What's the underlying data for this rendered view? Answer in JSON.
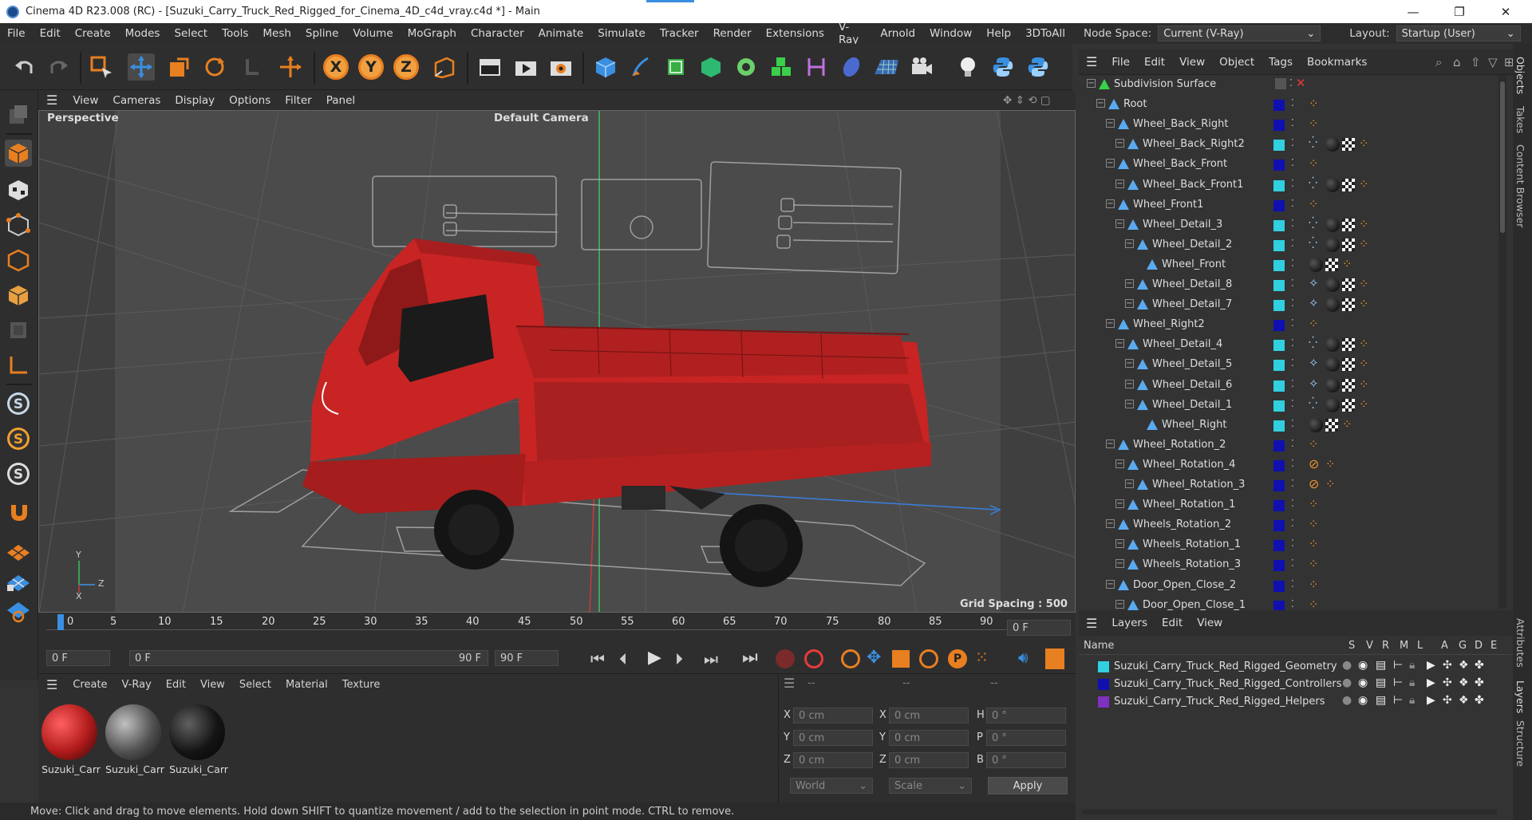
{
  "title_bar": {
    "title": "Cinema 4D R23.008 (RC) - [Suzuki_Carry_Truck_Red_Rigged_for_Cinema_4D_c4d_vray.c4d *] - Main",
    "minimize": "—",
    "restore": "❐",
    "close": "✕"
  },
  "menu": [
    "File",
    "Edit",
    "Create",
    "Modes",
    "Select",
    "Tools",
    "Mesh",
    "Spline",
    "Volume",
    "MoGraph",
    "Character",
    "Animate",
    "Simulate",
    "Tracker",
    "Render",
    "Extensions",
    "V-Ray",
    "Arnold",
    "Window",
    "Help",
    "3DToAll"
  ],
  "node_space": {
    "label": "Node Space:",
    "value": "Current (V-Ray)"
  },
  "layout": {
    "label": "Layout:",
    "value": "Startup (User)"
  },
  "axis_buttons": [
    "X",
    "Y",
    "Z"
  ],
  "viewport": {
    "menu": [
      "View",
      "Cameras",
      "Display",
      "Options",
      "Filter",
      "Panel"
    ],
    "view_name": "Perspective",
    "camera": "Default Camera",
    "grid_spacing": "Grid Spacing : 500 cm",
    "axis_labels": [
      "Y",
      "Z",
      "X"
    ]
  },
  "timeline": {
    "ticks": [
      "0",
      "5",
      "10",
      "15",
      "20",
      "25",
      "30",
      "35",
      "40",
      "45",
      "50",
      "55",
      "60",
      "65",
      "70",
      "75",
      "80",
      "85",
      "90"
    ],
    "current_frame": "0 F"
  },
  "transport": {
    "start": "0 F",
    "min": "0 F",
    "max_inner": "90 F",
    "end": "90 F"
  },
  "material_panel": {
    "menu": [
      "Create",
      "V-Ray",
      "Edit",
      "View",
      "Select",
      "Material",
      "Texture"
    ],
    "materials": [
      {
        "name": "Suzuki_Carr"
      },
      {
        "name": "Suzuki_Carr"
      },
      {
        "name": "Suzuki_Carr"
      }
    ]
  },
  "coords": {
    "headers": [
      "--",
      "--",
      "--"
    ],
    "rows": [
      {
        "a": "X",
        "av": "0 cm",
        "b": "X",
        "bv": "0 cm",
        "c": "H",
        "cv": "0 °"
      },
      {
        "a": "Y",
        "av": "0 cm",
        "b": "Y",
        "bv": "0 cm",
        "c": "P",
        "cv": "0 °"
      },
      {
        "a": "Z",
        "av": "0 cm",
        "b": "Z",
        "bv": "0 cm",
        "c": "B",
        "cv": "0 °"
      }
    ],
    "world": "World",
    "scale": "Scale",
    "apply": "Apply"
  },
  "status": "Move: Click and drag to move elements. Hold down SHIFT to quantize movement / add to the selection in point mode. CTRL to remove.",
  "object_manager": {
    "menu": [
      "File",
      "Edit",
      "View",
      "Object",
      "Tags",
      "Bookmarks"
    ],
    "objects": [
      {
        "name": "Subdivision Surface",
        "depth": 0,
        "color": "#ffffff",
        "tags": "sub"
      },
      {
        "name": "Root",
        "depth": 1,
        "color": "#1010b0",
        "tags": "d"
      },
      {
        "name": "Wheel_Back_Right",
        "depth": 2,
        "color": "#1010b0",
        "tags": "d"
      },
      {
        "name": "Wheel_Back_Right2",
        "depth": 3,
        "color": "#30d0e0",
        "tags": "full"
      },
      {
        "name": "Wheel_Back_Front",
        "depth": 2,
        "color": "#1010b0",
        "tags": "d"
      },
      {
        "name": "Wheel_Back_Front1",
        "depth": 3,
        "color": "#30d0e0",
        "tags": "full"
      },
      {
        "name": "Wheel_Front1",
        "depth": 2,
        "color": "#1010b0",
        "tags": "d"
      },
      {
        "name": "Wheel_Detail_3",
        "depth": 3,
        "color": "#30d0e0",
        "tags": "full"
      },
      {
        "name": "Wheel_Detail_2",
        "depth": 4,
        "color": "#30d0e0",
        "tags": "full"
      },
      {
        "name": "Wheel_Front",
        "depth": 5,
        "color": "#30d0e0",
        "tags": "mat"
      },
      {
        "name": "Wheel_Detail_8",
        "depth": 4,
        "color": "#30d0e0",
        "tags": "full2"
      },
      {
        "name": "Wheel_Detail_7",
        "depth": 4,
        "color": "#30d0e0",
        "tags": "full2"
      },
      {
        "name": "Wheel_Right2",
        "depth": 2,
        "color": "#1010b0",
        "tags": "d"
      },
      {
        "name": "Wheel_Detail_4",
        "depth": 3,
        "color": "#30d0e0",
        "tags": "full"
      },
      {
        "name": "Wheel_Detail_5",
        "depth": 4,
        "color": "#30d0e0",
        "tags": "full2"
      },
      {
        "name": "Wheel_Detail_6",
        "depth": 4,
        "color": "#30d0e0",
        "tags": "full2"
      },
      {
        "name": "Wheel_Detail_1",
        "depth": 4,
        "color": "#30d0e0",
        "tags": "full"
      },
      {
        "name": "Wheel_Right",
        "depth": 5,
        "color": "#30d0e0",
        "tags": "mat"
      },
      {
        "name": "Wheel_Rotation_2",
        "depth": 2,
        "color": "#1010b0",
        "tags": "d"
      },
      {
        "name": "Wheel_Rotation_4",
        "depth": 3,
        "color": "#1010b0",
        "tags": "ban"
      },
      {
        "name": "Wheel_Rotation_3",
        "depth": 4,
        "color": "#1010b0",
        "tags": "ban"
      },
      {
        "name": "Wheel_Rotation_1",
        "depth": 3,
        "color": "#1010b0",
        "tags": "d"
      },
      {
        "name": "Wheels_Rotation_2",
        "depth": 2,
        "color": "#1010b0",
        "tags": "d"
      },
      {
        "name": "Wheels_Rotation_1",
        "depth": 3,
        "color": "#1010b0",
        "tags": "d"
      },
      {
        "name": "Wheels_Rotation_3",
        "depth": 3,
        "color": "#1010b0",
        "tags": "d"
      },
      {
        "name": "Door_Open_Close_2",
        "depth": 2,
        "color": "#1010b0",
        "tags": "d"
      },
      {
        "name": "Door_Open_Close_1",
        "depth": 3,
        "color": "#1010b0",
        "tags": "d"
      }
    ]
  },
  "layer_manager": {
    "menu": [
      "Layers",
      "Edit",
      "View"
    ],
    "col_name": "Name",
    "cols": [
      "S",
      "V",
      "R",
      "M",
      "L",
      "A",
      "G",
      "D",
      "E"
    ],
    "layers": [
      {
        "name": "Suzuki_Carry_Truck_Red_Rigged_Geometry",
        "color": "#30d0e0"
      },
      {
        "name": "Suzuki_Carry_Truck_Red_Rigged_Controllers",
        "color": "#1010b0"
      },
      {
        "name": "Suzuki_Carry_Truck_Red_Rigged_Helpers",
        "color": "#8030c0"
      }
    ]
  },
  "right_tabs": [
    "Objects",
    "Takes",
    "Content Browser",
    "Attributes",
    "Layers",
    "Structure"
  ],
  "colors": {
    "truck_red": "#c82424",
    "accent_orange": "#e87f20",
    "blue_icon": "#3a8fe0"
  }
}
